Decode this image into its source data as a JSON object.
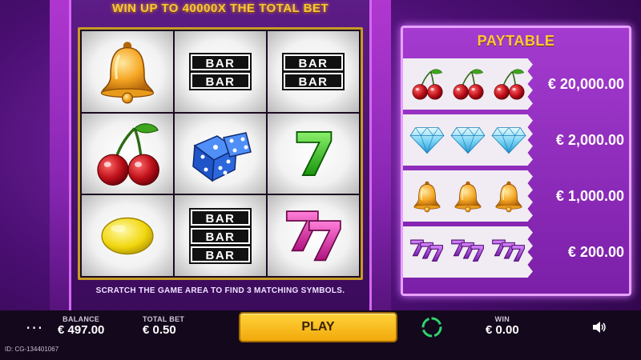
{
  "header": {
    "headline": "WIN UP TO 40000X THE TOTAL BET"
  },
  "board": {
    "instruction": "SCRATCH THE GAME AREA TO FIND 3 MATCHING SYMBOLS.",
    "bar_text": "BAR",
    "grid": [
      [
        "bell-icon",
        "double-bar",
        "double-bar"
      ],
      [
        "cherry-icon",
        "dice-icon",
        "green-seven"
      ],
      [
        "lemon-icon",
        "triple-bar",
        "double-pink-seven"
      ]
    ]
  },
  "paytable": {
    "title": "PAYTABLE",
    "rows": [
      {
        "symbol": "cherry-icon",
        "amount": "€ 20,000.00"
      },
      {
        "symbol": "diamond-icon",
        "amount": "€ 2,000.00"
      },
      {
        "symbol": "bell-icon",
        "amount": "€ 1,000.00"
      },
      {
        "symbol": "triple-seven-icon",
        "amount": "€ 200.00"
      }
    ]
  },
  "footer": {
    "menu": "···",
    "balance_label": "BALANCE",
    "balance_value": "€ 497.00",
    "total_bet_label": "TOTAL BET",
    "total_bet_value": "€ 0.50",
    "play_label": "PLAY",
    "win_label": "WIN",
    "win_value": "€ 0.00",
    "game_id": "ID: CG-134401067"
  },
  "colors": {
    "gold": "#f6c93c",
    "purple_bg": "#4b0f73",
    "paytable_purple": "#a43bd0",
    "play_yellow": "#ffd23a",
    "bottom_bar": "#14081d"
  }
}
